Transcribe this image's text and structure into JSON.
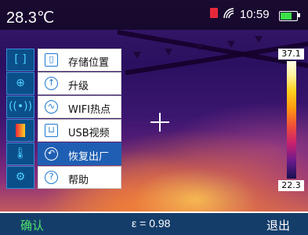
{
  "status": {
    "temperature": "28.3℃",
    "time": "10:59",
    "battery_level": 0.75,
    "icons": [
      "sd-card-icon",
      "wifi-icon",
      "battery-icon"
    ]
  },
  "menu": {
    "left_icons": [
      "capture-mode-icon",
      "center-target-icon",
      "emissivity-icon",
      "palette-icon",
      "temperature-icon",
      "settings-icon"
    ],
    "items": [
      {
        "label": "存储位置",
        "icon": "storage-icon",
        "glyph": "▯"
      },
      {
        "label": "升级",
        "icon": "upgrade-icon",
        "glyph": "↑"
      },
      {
        "label": "WIFI热点",
        "icon": "wifi-hotspot-icon",
        "glyph": "∿"
      },
      {
        "label": "USB视频",
        "icon": "usb-icon",
        "glyph": "⊔"
      },
      {
        "label": "恢复出厂",
        "icon": "reset-icon",
        "glyph": "↶",
        "selected": true
      },
      {
        "label": "帮助",
        "icon": "help-icon",
        "glyph": "?"
      }
    ]
  },
  "scale": {
    "max": "37.1",
    "min": "22.3"
  },
  "footer": {
    "confirm": "确认",
    "emissivity": "ε = 0.98",
    "exit": "退出"
  },
  "colors": {
    "accent": "#4fe36a",
    "menu_selected": "#1f5fb3",
    "footer_bg": "#143d6a"
  }
}
